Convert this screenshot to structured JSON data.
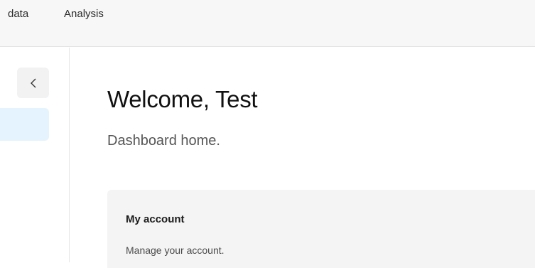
{
  "topnav": {
    "items": [
      {
        "label": "data"
      },
      {
        "label": "Analysis"
      }
    ]
  },
  "sidebar": {
    "collapse_icon": "chevron-left-icon",
    "collapse_glyph": "<",
    "active_item_color": "#e4f3fd"
  },
  "main": {
    "title": "Welcome, Test",
    "subtitle": "Dashboard home."
  },
  "card": {
    "title": "My account",
    "description": "Manage your account."
  }
}
